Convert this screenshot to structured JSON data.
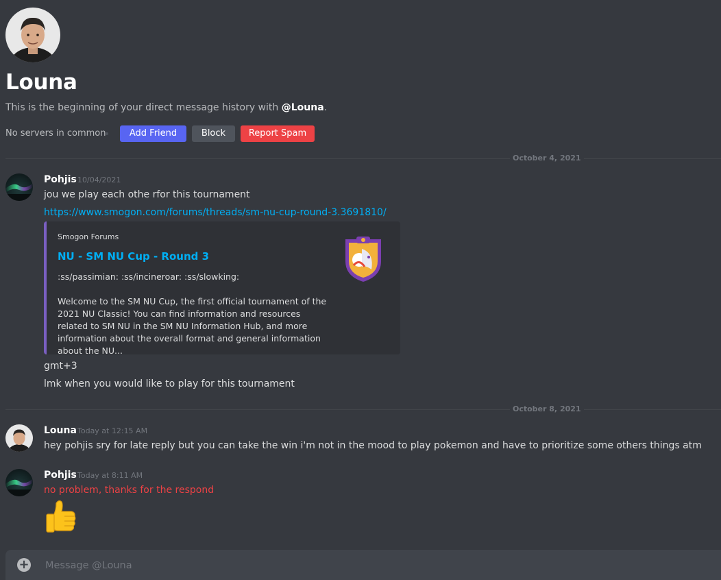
{
  "profile": {
    "name": "Louna",
    "intro_prefix": "This is the beginning of your direct message history with ",
    "intro_handle": "@Louna",
    "intro_suffix": ".",
    "servers": "No servers in common",
    "actions": {
      "add_friend": "Add Friend",
      "block": "Block",
      "report_spam": "Report Spam"
    }
  },
  "dividers": [
    "October 4, 2021",
    "October 8, 2021"
  ],
  "messages": [
    {
      "author": "Pohjis",
      "timestamp": "10/04/2021",
      "line1": "jou we play each othe rfor this tournament",
      "link": "https://www.smogon.com/forums/threads/sm-nu-cup-round-3.3691810/",
      "embed": {
        "provider": "Smogon Forums",
        "title": "NU - SM NU Cup - Round 3",
        "emotes": ":ss/passimian: :ss/incineroar: :ss/slowking:",
        "body": "Welcome to the SM NU Cup, the first official tournament of the 2021 NU Classic! You can find information and resources related to SM NU in the SM NU Information Hub, and more information about the overall format and general information about the NU..."
      },
      "line2": "gmt+3",
      "line3": "lmk when you would like to play for this tournament"
    },
    {
      "author": "Louna",
      "timestamp": "Today at 12:15 AM",
      "text": "hey pohjis sry for late reply but you can take the win i'm not in the mood to play pokemon and have to prioritize some others things atm"
    },
    {
      "author": "Pohjis",
      "timestamp": "Today at 8:11 AM",
      "text": "no problem, thanks for the respond",
      "emoji": "thumbs-up"
    }
  ],
  "composer": {
    "placeholder": "Message @Louna"
  },
  "colors": {
    "background": "#36393f",
    "blurple": "#5865f2",
    "danger": "#ed4245",
    "link": "#00aff4",
    "embed_accent": "#7a5fc2"
  }
}
